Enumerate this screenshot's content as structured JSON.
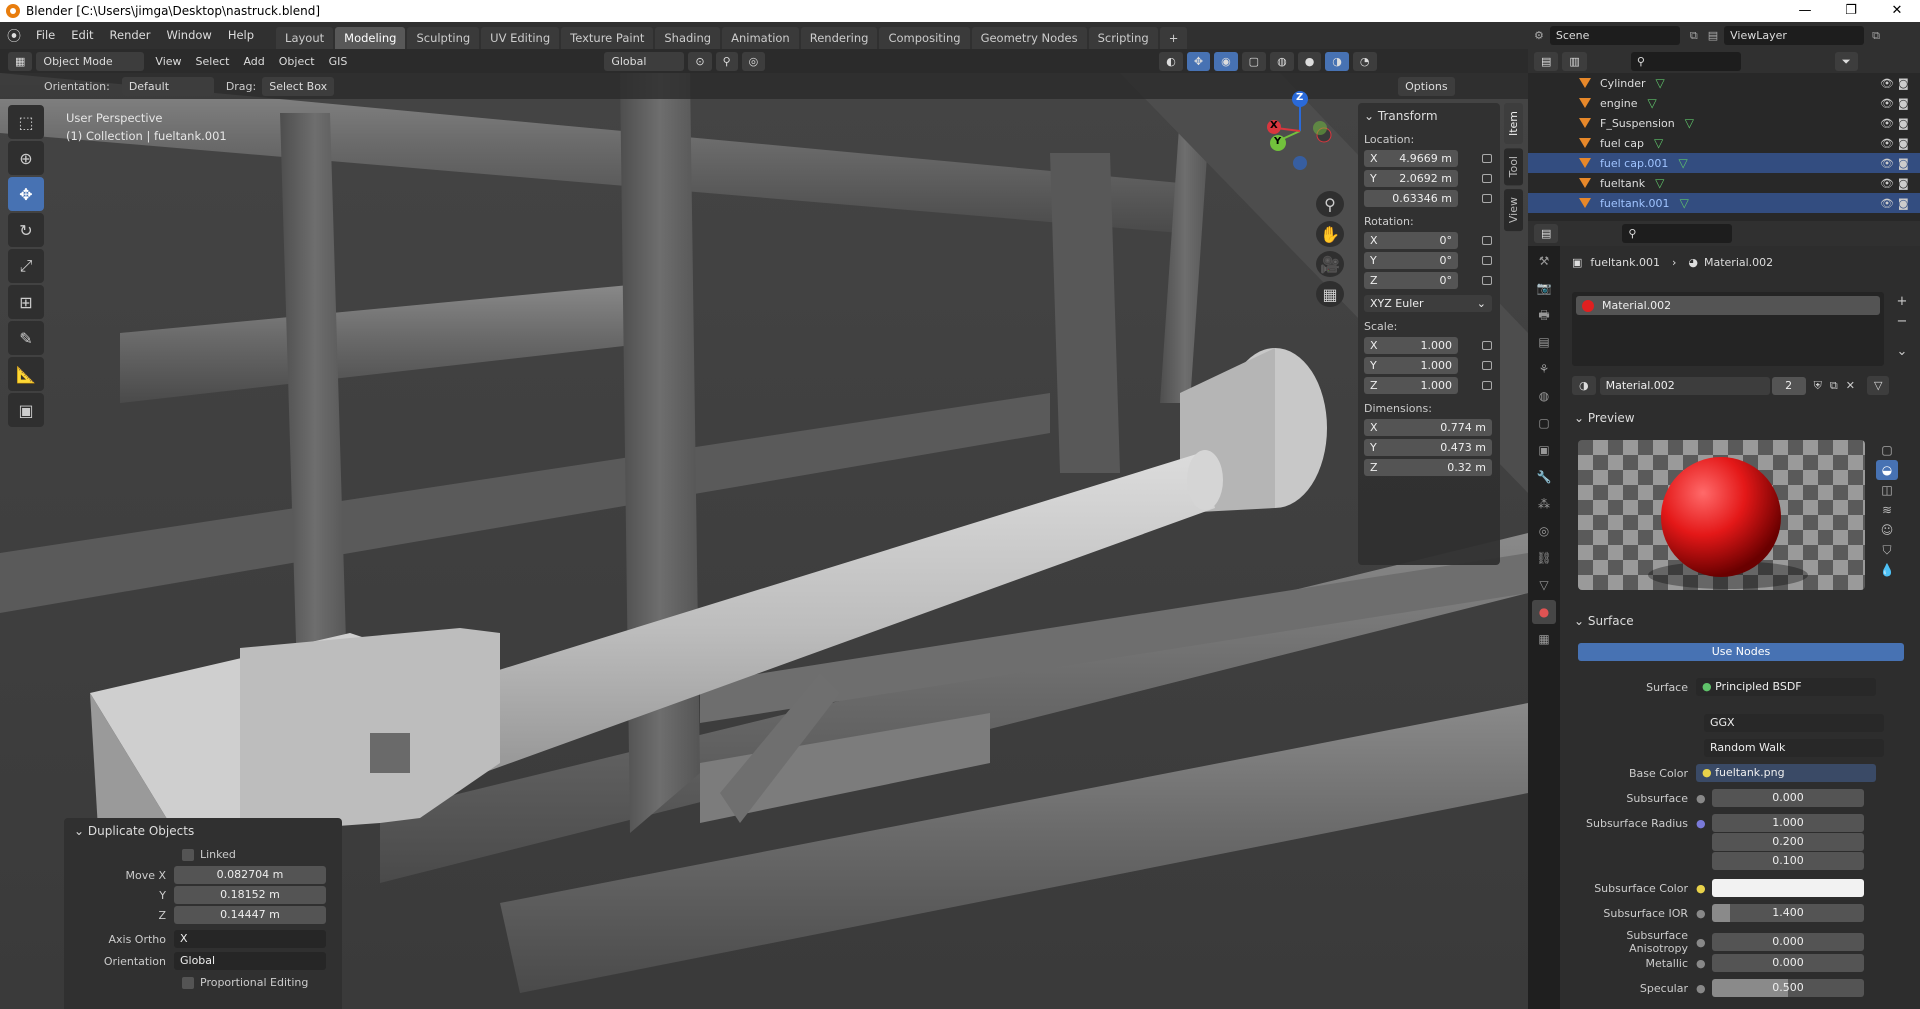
{
  "titlebar": {
    "title": "Blender [C:\\Users\\jimga\\Desktop\\nastruck.blend]",
    "min": "—",
    "max": "❐",
    "close": "✕"
  },
  "menu": [
    "File",
    "Edit",
    "Render",
    "Window",
    "Help"
  ],
  "workspaces": [
    "Layout",
    "Modeling",
    "Sculpting",
    "UV Editing",
    "Texture Paint",
    "Shading",
    "Animation",
    "Rendering",
    "Compositing",
    "Geometry Nodes",
    "Scripting",
    "+"
  ],
  "active_workspace": "Modeling",
  "scene": {
    "scene_label": "Scene",
    "viewlayer_label": "ViewLayer"
  },
  "viewport_header": {
    "mode": "Object Mode",
    "menus": [
      "View",
      "Select",
      "Add",
      "Object",
      "GIS"
    ],
    "transform_space": "Global",
    "orientation_label": "Orientation:",
    "orientation_value": "Default",
    "drag_label": "Drag:",
    "drag_value": "Select Box",
    "options": "Options"
  },
  "viewport_info": {
    "line1": "User Perspective",
    "line2": "(1) Collection | fueltank.001"
  },
  "gizmo": {
    "z": "Z",
    "y": "Y",
    "x": "X"
  },
  "side_tabs": [
    "Item",
    "Tool",
    "View"
  ],
  "npanel": {
    "title": "Transform",
    "location_label": "Location:",
    "location": [
      {
        "axis": "X",
        "value": "4.9669 m"
      },
      {
        "axis": "Y",
        "value": "2.0692 m"
      },
      {
        "axis": "",
        "value": "0.63346 m"
      }
    ],
    "rotation_label": "Rotation:",
    "rotation": [
      {
        "axis": "X",
        "value": "0°"
      },
      {
        "axis": "Y",
        "value": "0°"
      },
      {
        "axis": "Z",
        "value": "0°"
      }
    ],
    "rotation_mode": "XYZ Euler",
    "scale_label": "Scale:",
    "scale": [
      {
        "axis": "X",
        "value": "1.000"
      },
      {
        "axis": "Y",
        "value": "1.000"
      },
      {
        "axis": "Z",
        "value": "1.000"
      }
    ],
    "dimensions_label": "Dimensions:",
    "dimensions": [
      {
        "axis": "X",
        "value": "0.774 m"
      },
      {
        "axis": "Y",
        "value": "0.473 m"
      },
      {
        "axis": "Z",
        "value": "0.32 m"
      }
    ]
  },
  "redo_panel": {
    "title": "Duplicate Objects",
    "linked": "Linked",
    "move_x_label": "Move X",
    "move_x": "0.082704 m",
    "y_label": "Y",
    "y": "0.18152 m",
    "z_label": "Z",
    "z": "0.14447 m",
    "axis_ortho_label": "Axis Ortho",
    "axis_ortho": "X",
    "orientation_label": "Orientation",
    "orientation": "Global",
    "proportional": "Proportional Editing"
  },
  "outliner": {
    "rows": [
      {
        "name": "Cylinder",
        "selected": false
      },
      {
        "name": "engine",
        "selected": false
      },
      {
        "name": "F_Suspension",
        "selected": false
      },
      {
        "name": "fuel cap",
        "selected": false
      },
      {
        "name": "fuel cap.001",
        "selected": true
      },
      {
        "name": "fueltank",
        "selected": false
      },
      {
        "name": "fueltank.001",
        "selected": true
      }
    ]
  },
  "properties": {
    "breadcrumb_object": "fueltank.001",
    "breadcrumb_material": "Material.002",
    "slot_name": "Material.002",
    "material_name": "Material.002",
    "users": "2",
    "preview_label": "Preview",
    "surface_label": "Surface",
    "use_nodes": "Use Nodes",
    "surface_field_label": "Surface",
    "shader": "Principled BSDF",
    "distribution": "GGX",
    "subsurface_method": "Random Walk",
    "base_color_label": "Base Color",
    "base_color_tex": "fueltank.png",
    "subsurface_label": "Subsurface",
    "subsurface": "0.000",
    "subsurface_radius_label": "Subsurface Radius",
    "subsurface_radius": [
      "1.000",
      "0.200",
      "0.100"
    ],
    "subsurface_color_label": "Subsurface Color",
    "subsurface_ior_label": "Subsurface IOR",
    "subsurface_ior": "1.400",
    "subsurface_aniso_label": "Subsurface Anisotropy",
    "subsurface_aniso": "0.000",
    "metallic_label": "Metallic",
    "metallic": "0.000",
    "specular_label": "Specular",
    "specular": "0.500"
  },
  "colors": {
    "accent": "#4772b3",
    "selected_row": "#334d80",
    "material_red": "#e02020"
  }
}
